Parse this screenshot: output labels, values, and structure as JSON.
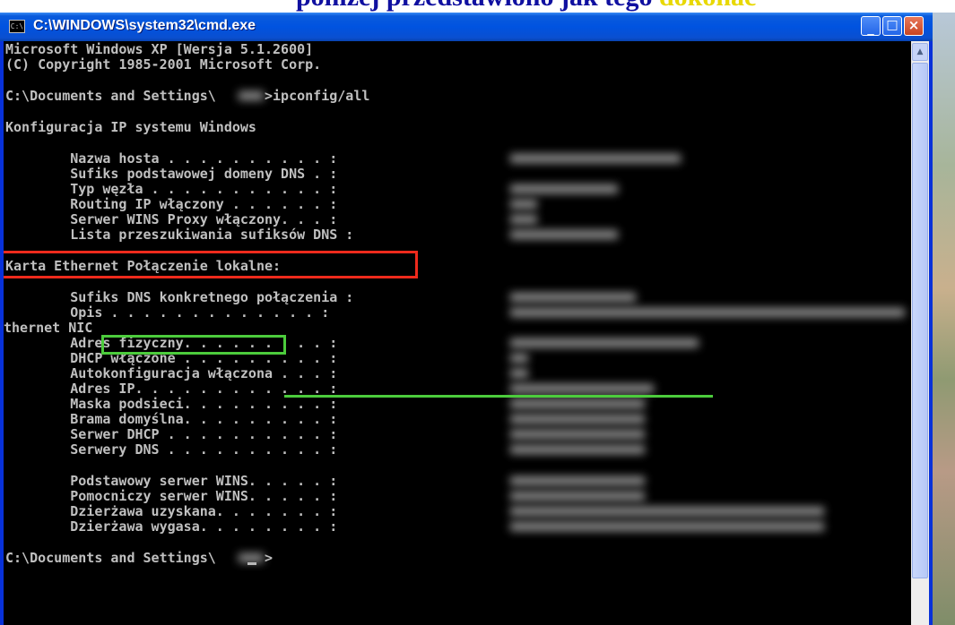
{
  "caption": {
    "text_before": "poniżej przedstawiono jak tego ",
    "text_highlight": "dokonać"
  },
  "window": {
    "title": "C:\\WINDOWS\\system32\\cmd.exe",
    "icon": "console-icon",
    "controls": {
      "minimize": "_",
      "maximize": "□",
      "close": "×"
    },
    "accent": "#0831d9"
  },
  "console": {
    "lines": [
      "Microsoft Windows XP [Wersja 5.1.2600]",
      "(C) Copyright 1985-2001 Microsoft Corp.",
      "C:\\Documents and Settings\\      >ipconfig/all",
      "Konfiguracja IP systemu Windows",
      "        Nazwa hosta . . . . . . . . . . :",
      "        Sufiks podstawowej domeny DNS . :",
      "        Typ węzła . . . . . . . . . . . :",
      "        Routing IP włączony . . . . . . :",
      "        Serwer WINS Proxy włączony. . . :",
      "        Lista przeszukiwania sufiksów DNS :",
      "Karta Ethernet Połączenie lokalne:",
      "        Sufiks DNS konkretnego połączenia :",
      "        Opis . . . . . . . . . . . . . :",
      "thernet NIC",
      "        Adres fizyczny. . . . . . . . . :",
      "        DHCP włączone . . . . . . . . . :",
      "        Autokonfiguracja włączona . . . :",
      "        Adres IP. . . . . . . . . . . . :",
      "        Maska podsieci. . . . . . . . . :",
      "        Brama domyślna. . . . . . . . . :",
      "        Serwer DHCP . . . . . . . . . . :",
      "        Serwery DNS . . . . . . . . . . :",
      "        Podstawowy serwer WINS. . . . . :",
      "        Pomocniczy serwer WINS. . . . . :",
      "        Dzierżawa uzyskana. . . . . . . :",
      "        Dzierżawa wygasa. . . . . . . . :",
      "C:\\Documents and Settings\\      >"
    ],
    "text_color": "#c0c0c0",
    "background": "#000000"
  },
  "annotations": {
    "red_color": "#ee2a1c",
    "green_color": "#4ccc3c"
  }
}
